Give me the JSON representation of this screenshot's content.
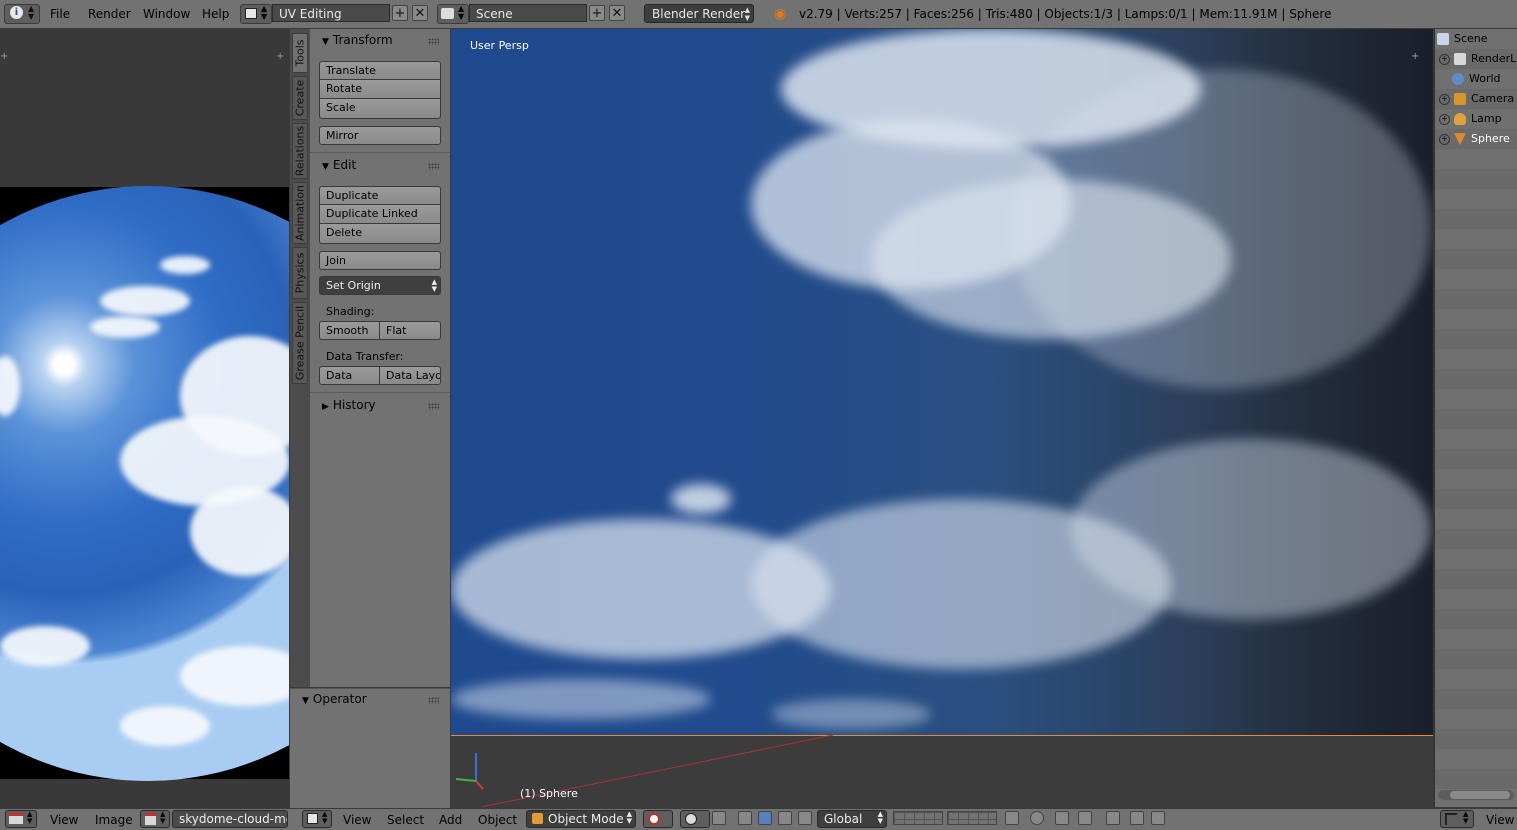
{
  "topbar": {
    "menus": [
      "File",
      "Render",
      "Window",
      "Help"
    ],
    "screen_layout": "UV Editing",
    "scene": "Scene",
    "render_engine": "Blender Render",
    "stats": "v2.79 | Verts:257 | Faces:256 | Tris:480 | Objects:1/3 | Lamps:0/1 | Mem:11.91M | Sphere"
  },
  "tool_tabs": [
    "Tools",
    "Create",
    "Relations",
    "Animation",
    "Physics",
    "Grease Pencil"
  ],
  "tool_shelf": {
    "transform": {
      "title": "Transform",
      "buttons": [
        "Translate",
        "Rotate",
        "Scale",
        "Mirror"
      ]
    },
    "edit": {
      "title": "Edit",
      "buttons": [
        "Duplicate",
        "Duplicate Linked",
        "Delete",
        "Join"
      ],
      "set_origin": "Set Origin",
      "shading_label": "Shading:",
      "smooth": "Smooth",
      "flat": "Flat",
      "data_transfer_label": "Data Transfer:",
      "data": "Data",
      "data_layout": "Data Layo"
    },
    "history": {
      "title": "History"
    },
    "operator": {
      "title": "Operator"
    }
  },
  "viewport": {
    "view_label": "User Persp",
    "object_label": "(1) Sphere",
    "horizon_color": "#f08a24"
  },
  "outliner": {
    "items": [
      {
        "label": "Scene",
        "icon": "scene-icon"
      },
      {
        "label": "RenderL",
        "icon": "render-layer-icon"
      },
      {
        "label": "World",
        "icon": "world-icon"
      },
      {
        "label": "Camera",
        "icon": "camera-icon"
      },
      {
        "label": "Lamp",
        "icon": "lamp-icon"
      },
      {
        "label": "Sphere",
        "icon": "mesh-icon"
      }
    ],
    "view_menu": "View"
  },
  "image_editor_header": {
    "menus": [
      "View",
      "Image"
    ],
    "image_name": "skydome-cloud-med..."
  },
  "viewport_header": {
    "menus": [
      "View",
      "Select",
      "Add",
      "Object"
    ],
    "mode": "Object Mode",
    "orientation": "Global"
  }
}
